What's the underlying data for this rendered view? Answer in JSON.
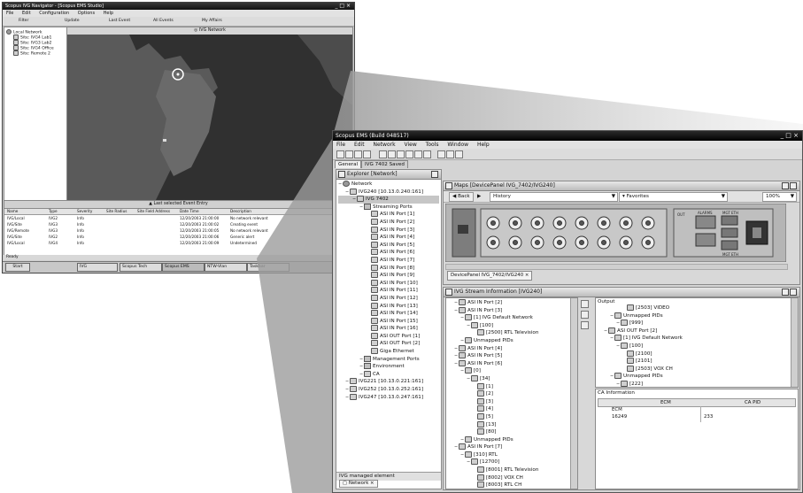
{
  "back_window": {
    "title": "Scopus IVG Navigator - [Scopus EMS Studio]",
    "menu": [
      "File",
      "Edit",
      "Configuration",
      "Options",
      "Help"
    ],
    "toolbar_labels": [
      "Filter",
      "Update",
      "Last Event",
      "All Events",
      "My Affairs"
    ],
    "map_header": "IVG Network",
    "tree_root": "Local Network",
    "tree_items": [
      "Site: IVG4 Lab1",
      "Site: IVG3 Lab2",
      "Site: IVG4 Office",
      "Site: Remote 2"
    ],
    "event_bar": "Last selected Event Entry",
    "table_headers": [
      "Name",
      "Type",
      "Severity",
      "Site Radius",
      "Site Field Address",
      "Date Time",
      "Description"
    ],
    "table_rows": [
      [
        "IVG/Local",
        "IVG2",
        "Info",
        "",
        "",
        "12/20/2003 21:00:00",
        "No network relevant"
      ],
      [
        "IVG/Site",
        "IVG3",
        "Info",
        "",
        "",
        "12/20/2003 21:00:02",
        "Creating event"
      ],
      [
        "IVG/Remote",
        "IVG3",
        "Info",
        "",
        "",
        "12/20/2003 21:00:05",
        "No network relevant"
      ],
      [
        "IVG/Site",
        "IVG2",
        "Info",
        "",
        "",
        "12/20/2003 21:00:06",
        "Generic alert"
      ],
      [
        "IVG/Local",
        "IVG4",
        "Info",
        "",
        "",
        "12/20/2003 21:00:09",
        "Undetermined"
      ]
    ],
    "status_label": "Ready",
    "taskbar_items": [
      "Start",
      "IVG",
      "Scopus Tech",
      "Scopus EMS",
      "NTW-Vlan",
      "Taskbar"
    ]
  },
  "front_window": {
    "title": "Scopus EMS (Build 048517)",
    "menu": [
      "File",
      "Edit",
      "Network",
      "View",
      "Tools",
      "Window",
      "Help"
    ],
    "tabs": [
      "General",
      "IVG 7402 Saved"
    ],
    "explorer": {
      "title": "Explorer [Network]",
      "items": [
        {
          "label": "Network",
          "level": 0,
          "icon": "network"
        },
        {
          "label": "IVG240 [10.13.0.240:161]",
          "level": 1,
          "icon": "device"
        },
        {
          "label": "IVG 7402",
          "level": 2,
          "icon": "device",
          "selected": true
        },
        {
          "label": "Streaming Ports",
          "level": 3,
          "icon": "folder"
        },
        {
          "label": "ASI IN Port [1]",
          "level": 4,
          "icon": "port"
        },
        {
          "label": "ASI IN Port [2]",
          "level": 4,
          "icon": "port"
        },
        {
          "label": "ASI IN Port [3]",
          "level": 4,
          "icon": "port"
        },
        {
          "label": "ASI IN Port [4]",
          "level": 4,
          "icon": "port"
        },
        {
          "label": "ASI IN Port [5]",
          "level": 4,
          "icon": "port"
        },
        {
          "label": "ASI IN Port [6]",
          "level": 4,
          "icon": "port"
        },
        {
          "label": "ASI IN Port [7]",
          "level": 4,
          "icon": "port"
        },
        {
          "label": "ASI IN Port [8]",
          "level": 4,
          "icon": "port"
        },
        {
          "label": "ASI IN Port [9]",
          "level": 4,
          "icon": "port"
        },
        {
          "label": "ASI IN Port [10]",
          "level": 4,
          "icon": "port"
        },
        {
          "label": "ASI IN Port [11]",
          "level": 4,
          "icon": "port"
        },
        {
          "label": "ASI IN Port [12]",
          "level": 4,
          "icon": "port"
        },
        {
          "label": "ASI IN Port [13]",
          "level": 4,
          "icon": "port"
        },
        {
          "label": "ASI IN Port [14]",
          "level": 4,
          "icon": "port"
        },
        {
          "label": "ASI IN Port [15]",
          "level": 4,
          "icon": "port"
        },
        {
          "label": "ASI IN Port [16]",
          "level": 4,
          "icon": "port"
        },
        {
          "label": "ASI OUT Port [1]",
          "level": 4,
          "icon": "port"
        },
        {
          "label": "ASI OUT Port [2]",
          "level": 4,
          "icon": "port"
        },
        {
          "label": "Giga Ethernet",
          "level": 4,
          "icon": "port"
        },
        {
          "label": "Management Ports",
          "level": 3,
          "icon": "folder"
        },
        {
          "label": "Environment",
          "level": 3,
          "icon": "folder"
        },
        {
          "label": "CA",
          "level": 3,
          "icon": "key"
        },
        {
          "label": "IVG221 [10.13.0.221:161]",
          "level": 1,
          "icon": "device"
        },
        {
          "label": "IVG252 [10.13.0.252:161]",
          "level": 1,
          "icon": "device"
        },
        {
          "label": "IVG247 [10.13.0.247:161]",
          "level": 1,
          "icon": "device"
        }
      ],
      "footer": "IVG managed element",
      "footer_tab": "Network"
    },
    "maps": {
      "title": "Maps [DevicePanel IVG_7402/IVG240]",
      "back": "Back",
      "history": "History",
      "favorites": "Favorites",
      "zoom": "100%",
      "panel_labels": [
        "OUT",
        "ALARMS",
        "MGT",
        "ETH",
        "MGT",
        "ETH"
      ],
      "tab": "DevicePanel IVG_7402/IVG240"
    },
    "stream": {
      "title": "IVG Stream Information [IVG240]",
      "left_items": [
        {
          "label": "ASI IN Port [2]",
          "level": 1
        },
        {
          "label": "ASI IN Port [3]",
          "level": 1
        },
        {
          "label": "[1] IVG Default Network",
          "level": 2
        },
        {
          "label": "[100]",
          "level": 3
        },
        {
          "label": "[2500] RTL Television",
          "level": 4
        },
        {
          "label": "Unmapped PIDs",
          "level": 2
        },
        {
          "label": "ASI IN Port [4]",
          "level": 1
        },
        {
          "label": "ASI IN Port [5]",
          "level": 1
        },
        {
          "label": "ASI IN Port [6]",
          "level": 1
        },
        {
          "label": "[0]",
          "level": 2
        },
        {
          "label": "[34]",
          "level": 3
        },
        {
          "label": "[1]",
          "level": 4
        },
        {
          "label": "[2]",
          "level": 4
        },
        {
          "label": "[3]",
          "level": 4
        },
        {
          "label": "[4]",
          "level": 4
        },
        {
          "label": "[5]",
          "level": 4
        },
        {
          "label": "[13]",
          "level": 4
        },
        {
          "label": "[80]",
          "level": 4
        },
        {
          "label": "Unmapped PIDs",
          "level": 2
        },
        {
          "label": "ASI IN Port [7]",
          "level": 1
        },
        {
          "label": "[310] RTL",
          "level": 2
        },
        {
          "label": "[12700]",
          "level": 3
        },
        {
          "label": "[8001] RTL Television",
          "level": 4
        },
        {
          "label": "[8002] VOX CH",
          "level": 4
        },
        {
          "label": "[8003] RTL CH",
          "level": 4
        }
      ],
      "output_title": "Output",
      "output_items": [
        {
          "label": "[2503] VIDEO",
          "level": 4
        },
        {
          "label": "Unmapped PIDs",
          "level": 2
        },
        {
          "label": "[999]",
          "level": 3
        },
        {
          "label": "ASI OUT Port [2]",
          "level": 1
        },
        {
          "label": "[1] IVG Default Network",
          "level": 2
        },
        {
          "label": "[100]",
          "level": 3
        },
        {
          "label": "[2100]",
          "level": 4
        },
        {
          "label": "[2101]",
          "level": 4
        },
        {
          "label": "[2503] VOX CH",
          "level": 4
        },
        {
          "label": "Unmapped PIDs",
          "level": 2
        },
        {
          "label": "[222]",
          "level": 3
        }
      ],
      "ca_title": "CA Information",
      "ca_headers": [
        "ECM",
        "CA PID"
      ],
      "ca_rows": [
        [
          "ECM",
          ""
        ],
        [
          "16249",
          "233"
        ]
      ]
    }
  }
}
